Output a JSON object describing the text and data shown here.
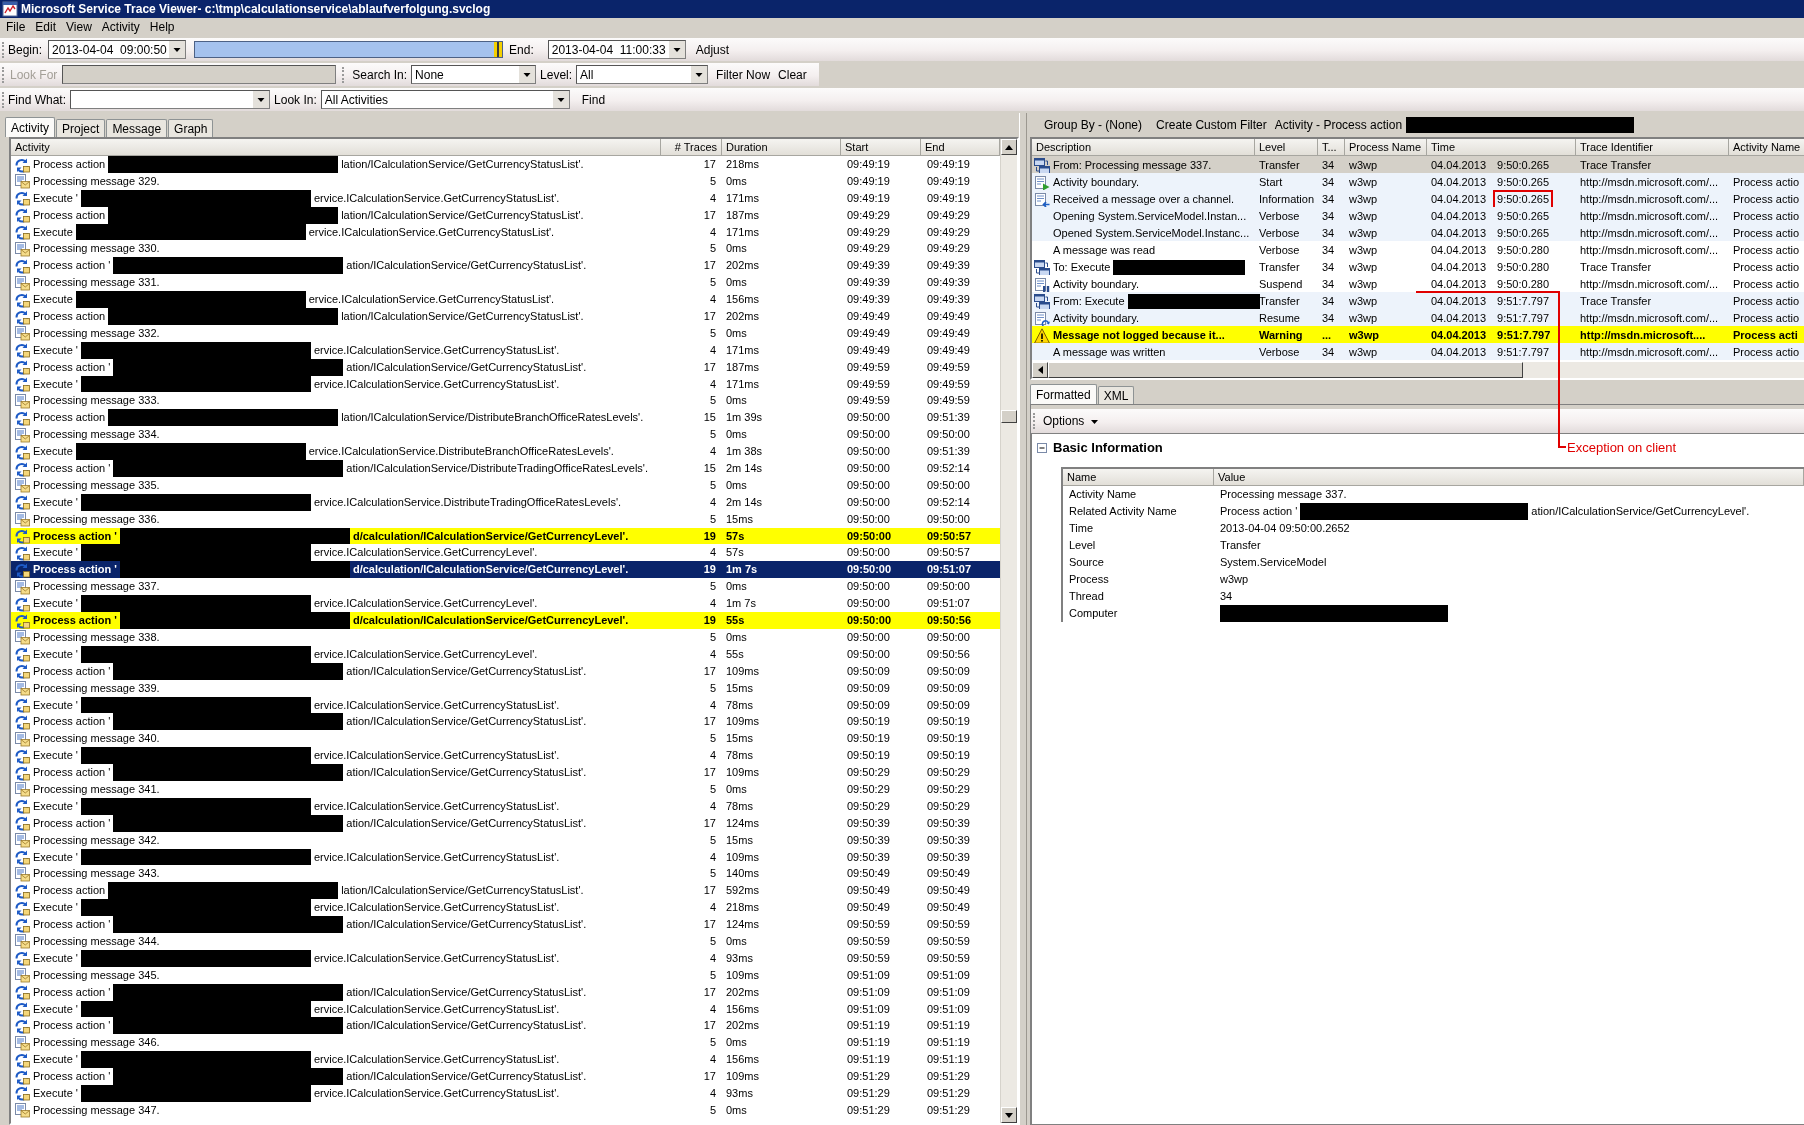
{
  "window": {
    "title": "Microsoft Service Trace Viewer- c:\\tmp\\calculationservice\\ablaufverfolgung.svclog"
  },
  "menu": [
    "File",
    "Edit",
    "View",
    "Activity",
    "Help"
  ],
  "time_bar": {
    "begin_label": "Begin:",
    "begin": "2013-04-04  09:00:50",
    "level": 1,
    "end_label": "End:",
    "end": "2013-04-04  11:00:33",
    "adjust": "Adjust"
  },
  "filter_bar": {
    "look_for": {
      "label": "Look For",
      "disabled": true
    },
    "search_in_label": "Search In:",
    "search_in": "None",
    "level_label": "Level:",
    "level_choice": "All",
    "filter_now": "Filter Now",
    "clear": "Clear"
  },
  "find_bar": {
    "find_what_label": "Find What:",
    "look_in_label": "Look In:",
    "look_in": "All Activities",
    "find": "Find"
  },
  "left_tabs": [
    {
      "label": "Activity",
      "selected": true
    },
    {
      "label": "Project",
      "selected": false
    },
    {
      "label": "Message",
      "selected": false
    },
    {
      "label": "Graph",
      "selected": false
    }
  ],
  "activity_table": {
    "columns": [
      "Activity",
      "# Traces",
      "Duration",
      "Start",
      "End"
    ],
    "rows": [
      {
        "kind": "activity",
        "lead": "Process action",
        "redacted": true,
        "tail": "lation/ICalculationService/GetCurrencyStatusList'.",
        "traces": "17",
        "duration": "218ms",
        "start": "09:49:19",
        "end": "09:49:19",
        "selected": false,
        "highlighted": false
      },
      {
        "kind": "message",
        "lead": "Processing message 329.",
        "redacted": false,
        "traces": "5",
        "duration": "0ms",
        "start": "09:49:19",
        "end": "09:49:19",
        "selected": false,
        "highlighted": false
      },
      {
        "kind": "activity",
        "lead": "Execute '",
        "redacted": true,
        "tail": "ervice.ICalculationService.GetCurrencyStatusList'.",
        "traces": "4",
        "duration": "171ms",
        "start": "09:49:19",
        "end": "09:49:19",
        "selected": false,
        "highlighted": false
      },
      {
        "kind": "activity",
        "lead": "Process action",
        "redacted": true,
        "tail": "lation/ICalculationService/GetCurrencyStatusList'.",
        "traces": "17",
        "duration": "187ms",
        "start": "09:49:29",
        "end": "09:49:29",
        "selected": false,
        "highlighted": false
      },
      {
        "kind": "activity",
        "lead": "Execute",
        "redacted": true,
        "tail": "ervice.ICalculationService.GetCurrencyStatusList'.",
        "traces": "4",
        "duration": "171ms",
        "start": "09:49:29",
        "end": "09:49:29",
        "selected": false,
        "highlighted": false
      },
      {
        "kind": "message",
        "lead": "Processing message 330.",
        "redacted": false,
        "traces": "5",
        "duration": "0ms",
        "start": "09:49:29",
        "end": "09:49:29",
        "selected": false,
        "highlighted": false
      },
      {
        "kind": "activity",
        "lead": "Process action '",
        "redacted": true,
        "tail": "ation/ICalculationService/GetCurrencyStatusList'.",
        "traces": "17",
        "duration": "202ms",
        "start": "09:49:39",
        "end": "09:49:39",
        "selected": false,
        "highlighted": false
      },
      {
        "kind": "message",
        "lead": "Processing message 331.",
        "redacted": false,
        "traces": "5",
        "duration": "0ms",
        "start": "09:49:39",
        "end": "09:49:39",
        "selected": false,
        "highlighted": false
      },
      {
        "kind": "activity",
        "lead": "Execute",
        "redacted": true,
        "tail": "ervice.ICalculationService.GetCurrencyStatusList'.",
        "traces": "4",
        "duration": "156ms",
        "start": "09:49:39",
        "end": "09:49:39",
        "selected": false,
        "highlighted": false
      },
      {
        "kind": "activity",
        "lead": "Process action",
        "redacted": true,
        "tail": "lation/ICalculationService/GetCurrencyStatusList'.",
        "traces": "17",
        "duration": "202ms",
        "start": "09:49:49",
        "end": "09:49:49",
        "selected": false,
        "highlighted": false
      },
      {
        "kind": "message",
        "lead": "Processing message 332.",
        "redacted": false,
        "traces": "5",
        "duration": "0ms",
        "start": "09:49:49",
        "end": "09:49:49",
        "selected": false,
        "highlighted": false
      },
      {
        "kind": "activity",
        "lead": "Execute '",
        "redacted": true,
        "tail": "ervice.ICalculationService.GetCurrencyStatusList'.",
        "traces": "4",
        "duration": "171ms",
        "start": "09:49:49",
        "end": "09:49:49",
        "selected": false,
        "highlighted": false
      },
      {
        "kind": "activity",
        "lead": "Process action '",
        "redacted": true,
        "tail": "ation/ICalculationService/GetCurrencyStatusList'.",
        "traces": "17",
        "duration": "187ms",
        "start": "09:49:59",
        "end": "09:49:59",
        "selected": false,
        "highlighted": false
      },
      {
        "kind": "activity",
        "lead": "Execute '",
        "redacted": true,
        "tail": "ervice.ICalculationService.GetCurrencyStatusList'.",
        "traces": "4",
        "duration": "171ms",
        "start": "09:49:59",
        "end": "09:49:59",
        "selected": false,
        "highlighted": false
      },
      {
        "kind": "message",
        "lead": "Processing message 333.",
        "redacted": false,
        "traces": "5",
        "duration": "0ms",
        "start": "09:49:59",
        "end": "09:49:59",
        "selected": false,
        "highlighted": false
      },
      {
        "kind": "activity",
        "lead": "Process action",
        "redacted": true,
        "tail": "lation/ICalculationService/DistributeBranchOfficeRatesLevels'.",
        "traces": "15",
        "duration": "1m 39s",
        "start": "09:50:00",
        "end": "09:51:39",
        "selected": false,
        "highlighted": false
      },
      {
        "kind": "message",
        "lead": "Processing message 334.",
        "redacted": false,
        "traces": "5",
        "duration": "0ms",
        "start": "09:50:00",
        "end": "09:50:00",
        "selected": false,
        "highlighted": false
      },
      {
        "kind": "activity",
        "lead": "Execute",
        "redacted": true,
        "tail": "ervice.ICalculationService.DistributeBranchOfficeRatesLevels'.",
        "traces": "4",
        "duration": "1m 38s",
        "start": "09:50:00",
        "end": "09:51:39",
        "selected": false,
        "highlighted": false
      },
      {
        "kind": "activity",
        "lead": "Process action '",
        "redacted": true,
        "tail": "ation/ICalculationService/DistributeTradingOfficeRatesLevels'.",
        "traces": "15",
        "duration": "2m 14s",
        "start": "09:50:00",
        "end": "09:52:14",
        "selected": false,
        "highlighted": false
      },
      {
        "kind": "message",
        "lead": "Processing message 335.",
        "redacted": false,
        "traces": "5",
        "duration": "0ms",
        "start": "09:50:00",
        "end": "09:50:00",
        "selected": false,
        "highlighted": false
      },
      {
        "kind": "activity",
        "lead": "Execute '",
        "redacted": true,
        "tail": "ervice.ICalculationService.DistributeTradingOfficeRatesLevels'.",
        "traces": "4",
        "duration": "2m 14s",
        "start": "09:50:00",
        "end": "09:52:14",
        "selected": false,
        "highlighted": false
      },
      {
        "kind": "message",
        "lead": "Processing message 336.",
        "redacted": false,
        "traces": "5",
        "duration": "15ms",
        "start": "09:50:00",
        "end": "09:50:00",
        "selected": false,
        "highlighted": false
      },
      {
        "kind": "activity",
        "lead": "Process action '",
        "redacted": true,
        "tail": "d/calculation/ICalculationService/GetCurrencyLevel'.",
        "traces": "19",
        "duration": "57s",
        "start": "09:50:00",
        "end": "09:50:57",
        "selected": false,
        "highlighted": true
      },
      {
        "kind": "activity",
        "lead": "Execute '",
        "redacted": true,
        "tail": "ervice.ICalculationService.GetCurrencyLevel'.",
        "traces": "4",
        "duration": "57s",
        "start": "09:50:00",
        "end": "09:50:57",
        "selected": false,
        "highlighted": false
      },
      {
        "kind": "activity",
        "lead": "Process action '",
        "redacted": true,
        "tail": "d/calculation/ICalculationService/GetCurrencyLevel'.",
        "traces": "19",
        "duration": "1m 7s",
        "start": "09:50:00",
        "end": "09:51:07",
        "selected": true,
        "highlighted": false
      },
      {
        "kind": "message",
        "lead": "Processing message 337.",
        "redacted": false,
        "traces": "5",
        "duration": "0ms",
        "start": "09:50:00",
        "end": "09:50:00",
        "selected": false,
        "highlighted": false
      },
      {
        "kind": "activity",
        "lead": "Execute '",
        "redacted": true,
        "tail": "ervice.ICalculationService.GetCurrencyLevel'.",
        "traces": "4",
        "duration": "1m 7s",
        "start": "09:50:00",
        "end": "09:51:07",
        "selected": false,
        "highlighted": false
      },
      {
        "kind": "activity",
        "lead": "Process action '",
        "redacted": true,
        "tail": "d/calculation/ICalculationService/GetCurrencyLevel'.",
        "traces": "19",
        "duration": "55s",
        "start": "09:50:00",
        "end": "09:50:56",
        "selected": false,
        "highlighted": true
      },
      {
        "kind": "message",
        "lead": "Processing message 338.",
        "redacted": false,
        "traces": "5",
        "duration": "0ms",
        "start": "09:50:00",
        "end": "09:50:00",
        "selected": false,
        "highlighted": false
      },
      {
        "kind": "activity",
        "lead": "Execute '",
        "redacted": true,
        "tail": "ervice.ICalculationService.GetCurrencyLevel'.",
        "traces": "4",
        "duration": "55s",
        "start": "09:50:00",
        "end": "09:50:56",
        "selected": false,
        "highlighted": false
      },
      {
        "kind": "activity",
        "lead": "Process action '",
        "redacted": true,
        "tail": "ation/ICalculationService/GetCurrencyStatusList'.",
        "traces": "17",
        "duration": "109ms",
        "start": "09:50:09",
        "end": "09:50:09",
        "selected": false,
        "highlighted": false
      },
      {
        "kind": "message",
        "lead": "Processing message 339.",
        "redacted": false,
        "traces": "5",
        "duration": "15ms",
        "start": "09:50:09",
        "end": "09:50:09",
        "selected": false,
        "highlighted": false
      },
      {
        "kind": "activity",
        "lead": "Execute '",
        "redacted": true,
        "tail": "ervice.ICalculationService.GetCurrencyStatusList'.",
        "traces": "4",
        "duration": "78ms",
        "start": "09:50:09",
        "end": "09:50:09",
        "selected": false,
        "highlighted": false
      },
      {
        "kind": "activity",
        "lead": "Process action '",
        "redacted": true,
        "tail": "ation/ICalculationService/GetCurrencyStatusList'.",
        "traces": "17",
        "duration": "109ms",
        "start": "09:50:19",
        "end": "09:50:19",
        "selected": false,
        "highlighted": false
      },
      {
        "kind": "message",
        "lead": "Processing message 340.",
        "redacted": false,
        "traces": "5",
        "duration": "15ms",
        "start": "09:50:19",
        "end": "09:50:19",
        "selected": false,
        "highlighted": false
      },
      {
        "kind": "activity",
        "lead": "Execute '",
        "redacted": true,
        "tail": "ervice.ICalculationService.GetCurrencyStatusList'.",
        "traces": "4",
        "duration": "78ms",
        "start": "09:50:19",
        "end": "09:50:19",
        "selected": false,
        "highlighted": false
      },
      {
        "kind": "activity",
        "lead": "Process action '",
        "redacted": true,
        "tail": "ation/ICalculationService/GetCurrencyStatusList'.",
        "traces": "17",
        "duration": "109ms",
        "start": "09:50:29",
        "end": "09:50:29",
        "selected": false,
        "highlighted": false
      },
      {
        "kind": "message",
        "lead": "Processing message 341.",
        "redacted": false,
        "traces": "5",
        "duration": "0ms",
        "start": "09:50:29",
        "end": "09:50:29",
        "selected": false,
        "highlighted": false
      },
      {
        "kind": "activity",
        "lead": "Execute '",
        "redacted": true,
        "tail": "ervice.ICalculationService.GetCurrencyStatusList'.",
        "traces": "4",
        "duration": "78ms",
        "start": "09:50:29",
        "end": "09:50:29",
        "selected": false,
        "highlighted": false
      },
      {
        "kind": "activity",
        "lead": "Process action '",
        "redacted": true,
        "tail": "ation/ICalculationService/GetCurrencyStatusList'.",
        "traces": "17",
        "duration": "124ms",
        "start": "09:50:39",
        "end": "09:50:39",
        "selected": false,
        "highlighted": false
      },
      {
        "kind": "message",
        "lead": "Processing message 342.",
        "redacted": false,
        "traces": "5",
        "duration": "15ms",
        "start": "09:50:39",
        "end": "09:50:39",
        "selected": false,
        "highlighted": false
      },
      {
        "kind": "activity",
        "lead": "Execute '",
        "redacted": true,
        "tail": "ervice.ICalculationService.GetCurrencyStatusList'.",
        "traces": "4",
        "duration": "109ms",
        "start": "09:50:39",
        "end": "09:50:39",
        "selected": false,
        "highlighted": false
      },
      {
        "kind": "message",
        "lead": "Processing message 343.",
        "redacted": false,
        "traces": "5",
        "duration": "140ms",
        "start": "09:50:49",
        "end": "09:50:49",
        "selected": false,
        "highlighted": false
      },
      {
        "kind": "activity",
        "lead": "Process action",
        "redacted": true,
        "tail": "lation/ICalculationService/GetCurrencyStatusList'.",
        "traces": "17",
        "duration": "592ms",
        "start": "09:50:49",
        "end": "09:50:49",
        "selected": false,
        "highlighted": false
      },
      {
        "kind": "activity",
        "lead": "Execute '",
        "redacted": true,
        "tail": "ervice.ICalculationService.GetCurrencyStatusList'.",
        "traces": "4",
        "duration": "218ms",
        "start": "09:50:49",
        "end": "09:50:49",
        "selected": false,
        "highlighted": false
      },
      {
        "kind": "activity",
        "lead": "Process action '",
        "redacted": true,
        "tail": "ation/ICalculationService/GetCurrencyStatusList'.",
        "traces": "17",
        "duration": "124ms",
        "start": "09:50:59",
        "end": "09:50:59",
        "selected": false,
        "highlighted": false
      },
      {
        "kind": "message",
        "lead": "Processing message 344.",
        "redacted": false,
        "traces": "5",
        "duration": "0ms",
        "start": "09:50:59",
        "end": "09:50:59",
        "selected": false,
        "highlighted": false
      },
      {
        "kind": "activity",
        "lead": "Execute '",
        "redacted": true,
        "tail": "ervice.ICalculationService.GetCurrencyStatusList'.",
        "traces": "4",
        "duration": "93ms",
        "start": "09:50:59",
        "end": "09:50:59",
        "selected": false,
        "highlighted": false
      },
      {
        "kind": "message",
        "lead": "Processing message 345.",
        "redacted": false,
        "traces": "5",
        "duration": "109ms",
        "start": "09:51:09",
        "end": "09:51:09",
        "selected": false,
        "highlighted": false
      },
      {
        "kind": "activity",
        "lead": "Process action '",
        "redacted": true,
        "tail": "ation/ICalculationService/GetCurrencyStatusList'.",
        "traces": "17",
        "duration": "202ms",
        "start": "09:51:09",
        "end": "09:51:09",
        "selected": false,
        "highlighted": false
      },
      {
        "kind": "activity",
        "lead": "Execute '",
        "redacted": true,
        "tail": "ervice.ICalculationService.GetCurrencyStatusList'.",
        "traces": "4",
        "duration": "156ms",
        "start": "09:51:09",
        "end": "09:51:09",
        "selected": false,
        "highlighted": false
      },
      {
        "kind": "activity",
        "lead": "Process action '",
        "redacted": true,
        "tail": "ation/ICalculationService/GetCurrencyStatusList'.",
        "traces": "17",
        "duration": "202ms",
        "start": "09:51:19",
        "end": "09:51:19",
        "selected": false,
        "highlighted": false
      },
      {
        "kind": "message",
        "lead": "Processing message 346.",
        "redacted": false,
        "traces": "5",
        "duration": "0ms",
        "start": "09:51:19",
        "end": "09:51:19",
        "selected": false,
        "highlighted": false
      },
      {
        "kind": "activity",
        "lead": "Execute '",
        "redacted": true,
        "tail": "ervice.ICalculationService.GetCurrencyStatusList'.",
        "traces": "4",
        "duration": "156ms",
        "start": "09:51:19",
        "end": "09:51:19",
        "selected": false,
        "highlighted": false
      },
      {
        "kind": "activity",
        "lead": "Process action '",
        "redacted": true,
        "tail": "ation/ICalculationService/GetCurrencyStatusList'.",
        "traces": "17",
        "duration": "109ms",
        "start": "09:51:29",
        "end": "09:51:29",
        "selected": false,
        "highlighted": false
      },
      {
        "kind": "activity",
        "lead": "Execute '",
        "redacted": true,
        "tail": "ervice.ICalculationService.GetCurrencyStatusList'.",
        "traces": "4",
        "duration": "93ms",
        "start": "09:51:29",
        "end": "09:51:29",
        "selected": false,
        "highlighted": false
      },
      {
        "kind": "message",
        "lead": "Processing message 347.",
        "redacted": false,
        "traces": "5",
        "duration": "0ms",
        "start": "09:51:29",
        "end": "09:51:29",
        "selected": false,
        "highlighted": false
      }
    ]
  },
  "trace_toolbar": {
    "group_by": "Group By - (None)",
    "custom_filter": "Create Custom Filter",
    "activity": "Activity - Process action",
    "redacted": true
  },
  "trace_table": {
    "columns": [
      "Description",
      "Level",
      "T...",
      "Process Name",
      "Time",
      "Trace Identifier",
      "Activity Name"
    ],
    "rows": [
      {
        "kind": "transfer",
        "description": "From: Processing message 337.",
        "redacted": false,
        "trace_level": "Transfer",
        "thread": "34",
        "process": "w3wp",
        "date": "04.04.2013",
        "clock": "9:50:0.265",
        "identifier": "Trace Transfer",
        "selected": true,
        "shaded": false,
        "highlighted": false,
        "marked": false
      },
      {
        "kind": "start",
        "description": "Activity boundary.",
        "redacted": false,
        "trace_level": "Start",
        "thread": "34",
        "process": "w3wp",
        "date": "04.04.2013",
        "clock": "9:50:0.265",
        "identifier": "http://msdn.microsoft.com/...",
        "activity": "Process actio",
        "selected": false,
        "shaded": true,
        "highlighted": false,
        "marked": false
      },
      {
        "kind": "receive",
        "description": "Received a message over a channel.",
        "redacted": false,
        "trace_level": "Information",
        "thread": "34",
        "process": "w3wp",
        "date": "04.04.2013",
        "clock": "9:50:0.265",
        "identifier": "http://msdn.microsoft.com/...",
        "activity": "Process actio",
        "selected": false,
        "shaded": true,
        "highlighted": false,
        "marked": true
      },
      {
        "kind": "plain",
        "description": "Opening System.ServiceModel.Instan...",
        "redacted": false,
        "trace_level": "Verbose",
        "thread": "34",
        "process": "w3wp",
        "date": "04.04.2013",
        "clock": "9:50:0.265",
        "identifier": "http://msdn.microsoft.com/...",
        "activity": "Process actio",
        "selected": false,
        "shaded": true,
        "highlighted": false,
        "marked": false
      },
      {
        "kind": "plain",
        "description": "Opened System.ServiceModel.Instanc...",
        "redacted": false,
        "trace_level": "Verbose",
        "thread": "34",
        "process": "w3wp",
        "date": "04.04.2013",
        "clock": "9:50:0.265",
        "identifier": "http://msdn.microsoft.com/...",
        "activity": "Process actio",
        "selected": false,
        "shaded": true,
        "highlighted": false,
        "marked": false
      },
      {
        "kind": "plain",
        "description": "A message was read",
        "redacted": false,
        "trace_level": "Verbose",
        "thread": "34",
        "process": "w3wp",
        "date": "04.04.2013",
        "clock": "9:50:0.280",
        "identifier": "http://msdn.microsoft.com/...",
        "activity": "Process actio",
        "selected": false,
        "shaded": false,
        "highlighted": false,
        "marked": false
      },
      {
        "kind": "transfer",
        "description": "To: Execute",
        "redacted": true,
        "trace_level": "Transfer",
        "thread": "34",
        "process": "w3wp",
        "date": "04.04.2013",
        "clock": "9:50:0.280",
        "identifier": "Trace Transfer",
        "activity": "Process actio",
        "selected": false,
        "shaded": false,
        "highlighted": false,
        "marked": false
      },
      {
        "kind": "suspend",
        "description": "Activity boundary.",
        "redacted": false,
        "trace_level": "Suspend",
        "thread": "34",
        "process": "w3wp",
        "date": "04.04.2013",
        "clock": "9:50:0.280",
        "identifier": "http://msdn.microsoft.com/...",
        "activity": "Process actio",
        "selected": false,
        "shaded": false,
        "highlighted": false,
        "marked": false
      },
      {
        "kind": "transfer",
        "description": "From: Execute",
        "redacted": true,
        "trace_level": "Transfer",
        "thread": "34",
        "process": "w3wp",
        "date": "04.04.2013",
        "clock": "9:51:7.797",
        "identifier": "Trace Transfer",
        "activity": "Process actio",
        "selected": false,
        "shaded": true,
        "highlighted": false,
        "marked": false
      },
      {
        "kind": "resume",
        "description": "Activity boundary.",
        "redacted": false,
        "trace_level": "Resume",
        "thread": "34",
        "process": "w3wp",
        "date": "04.04.2013",
        "clock": "9:51:7.797",
        "identifier": "http://msdn.microsoft.com/...",
        "activity": "Process actio",
        "selected": false,
        "shaded": true,
        "highlighted": false,
        "marked": false
      },
      {
        "kind": "warning",
        "description": "Message not logged because it...",
        "redacted": false,
        "trace_level": "Warning",
        "thread": "...",
        "process": "w3wp",
        "date": "04.04.2013",
        "clock": "9:51:7.797",
        "identifier": "http://msdn.microsoft....",
        "activity": "Process acti",
        "selected": false,
        "shaded": false,
        "highlighted": true,
        "marked": false
      },
      {
        "kind": "plain",
        "description": "A message was written",
        "redacted": false,
        "trace_level": "Verbose",
        "thread": "34",
        "process": "w3wp",
        "date": "04.04.2013",
        "clock": "9:51:7.797",
        "identifier": "http://msdn.microsoft.com/...",
        "activity": "Process actio",
        "selected": false,
        "shaded": true,
        "highlighted": false,
        "marked": false
      }
    ]
  },
  "detail_tabs": [
    {
      "label": "Formatted",
      "selected": true
    },
    {
      "label": "XML",
      "selected": false
    }
  ],
  "detail_toolbar": {
    "options": "Options"
  },
  "basic_information": {
    "title": "Basic Information",
    "expanded": true,
    "columns": [
      "Name",
      "Value"
    ],
    "rows": [
      {
        "name": "Activity Name",
        "value": "Processing message 337."
      },
      {
        "name": "Related Activity Name",
        "value": "Process action '",
        "redacted": true,
        "tail": "ation/ICalculationService/GetCurrencyLevel'."
      },
      {
        "name": "Time",
        "value": "2013-04-04 09:50:00.2652"
      },
      {
        "name": "Level",
        "value": "Transfer"
      },
      {
        "name": "Source",
        "value": "System.ServiceModel"
      },
      {
        "name": "Process",
        "value": "w3wp"
      },
      {
        "name": "Thread",
        "value": "34"
      },
      {
        "name": "Computer",
        "redacted": true
      }
    ]
  },
  "annotation": {
    "label": "Exception on client"
  }
}
